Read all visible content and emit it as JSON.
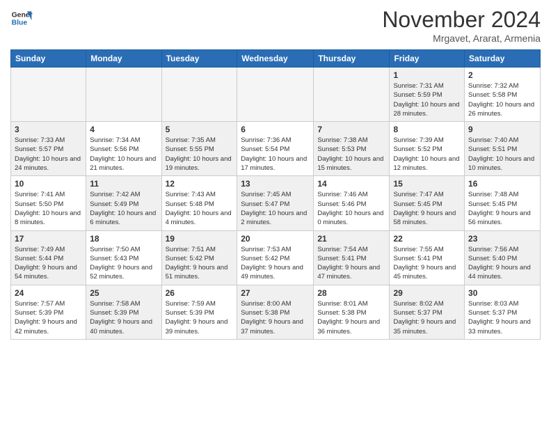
{
  "header": {
    "logo_line1": "General",
    "logo_line2": "Blue",
    "month": "November 2024",
    "location": "Mrgavet, Ararat, Armenia"
  },
  "weekdays": [
    "Sunday",
    "Monday",
    "Tuesday",
    "Wednesday",
    "Thursday",
    "Friday",
    "Saturday"
  ],
  "weeks": [
    [
      {
        "day": "",
        "info": "",
        "empty": true
      },
      {
        "day": "",
        "info": "",
        "empty": true
      },
      {
        "day": "",
        "info": "",
        "empty": true
      },
      {
        "day": "",
        "info": "",
        "empty": true
      },
      {
        "day": "",
        "info": "",
        "empty": true
      },
      {
        "day": "1",
        "info": "Sunrise: 7:31 AM\nSunset: 5:59 PM\nDaylight: 10 hours and 28 minutes.",
        "shaded": true
      },
      {
        "day": "2",
        "info": "Sunrise: 7:32 AM\nSunset: 5:58 PM\nDaylight: 10 hours and 26 minutes.",
        "shaded": false
      }
    ],
    [
      {
        "day": "3",
        "info": "Sunrise: 7:33 AM\nSunset: 5:57 PM\nDaylight: 10 hours and 24 minutes.",
        "shaded": true
      },
      {
        "day": "4",
        "info": "Sunrise: 7:34 AM\nSunset: 5:56 PM\nDaylight: 10 hours and 21 minutes.",
        "shaded": false
      },
      {
        "day": "5",
        "info": "Sunrise: 7:35 AM\nSunset: 5:55 PM\nDaylight: 10 hours and 19 minutes.",
        "shaded": true
      },
      {
        "day": "6",
        "info": "Sunrise: 7:36 AM\nSunset: 5:54 PM\nDaylight: 10 hours and 17 minutes.",
        "shaded": false
      },
      {
        "day": "7",
        "info": "Sunrise: 7:38 AM\nSunset: 5:53 PM\nDaylight: 10 hours and 15 minutes.",
        "shaded": true
      },
      {
        "day": "8",
        "info": "Sunrise: 7:39 AM\nSunset: 5:52 PM\nDaylight: 10 hours and 12 minutes.",
        "shaded": false
      },
      {
        "day": "9",
        "info": "Sunrise: 7:40 AM\nSunset: 5:51 PM\nDaylight: 10 hours and 10 minutes.",
        "shaded": true
      }
    ],
    [
      {
        "day": "10",
        "info": "Sunrise: 7:41 AM\nSunset: 5:50 PM\nDaylight: 10 hours and 8 minutes.",
        "shaded": false
      },
      {
        "day": "11",
        "info": "Sunrise: 7:42 AM\nSunset: 5:49 PM\nDaylight: 10 hours and 6 minutes.",
        "shaded": true
      },
      {
        "day": "12",
        "info": "Sunrise: 7:43 AM\nSunset: 5:48 PM\nDaylight: 10 hours and 4 minutes.",
        "shaded": false
      },
      {
        "day": "13",
        "info": "Sunrise: 7:45 AM\nSunset: 5:47 PM\nDaylight: 10 hours and 2 minutes.",
        "shaded": true
      },
      {
        "day": "14",
        "info": "Sunrise: 7:46 AM\nSunset: 5:46 PM\nDaylight: 10 hours and 0 minutes.",
        "shaded": false
      },
      {
        "day": "15",
        "info": "Sunrise: 7:47 AM\nSunset: 5:45 PM\nDaylight: 9 hours and 58 minutes.",
        "shaded": true
      },
      {
        "day": "16",
        "info": "Sunrise: 7:48 AM\nSunset: 5:45 PM\nDaylight: 9 hours and 56 minutes.",
        "shaded": false
      }
    ],
    [
      {
        "day": "17",
        "info": "Sunrise: 7:49 AM\nSunset: 5:44 PM\nDaylight: 9 hours and 54 minutes.",
        "shaded": true
      },
      {
        "day": "18",
        "info": "Sunrise: 7:50 AM\nSunset: 5:43 PM\nDaylight: 9 hours and 52 minutes.",
        "shaded": false
      },
      {
        "day": "19",
        "info": "Sunrise: 7:51 AM\nSunset: 5:42 PM\nDaylight: 9 hours and 51 minutes.",
        "shaded": true
      },
      {
        "day": "20",
        "info": "Sunrise: 7:53 AM\nSunset: 5:42 PM\nDaylight: 9 hours and 49 minutes.",
        "shaded": false
      },
      {
        "day": "21",
        "info": "Sunrise: 7:54 AM\nSunset: 5:41 PM\nDaylight: 9 hours and 47 minutes.",
        "shaded": true
      },
      {
        "day": "22",
        "info": "Sunrise: 7:55 AM\nSunset: 5:41 PM\nDaylight: 9 hours and 45 minutes.",
        "shaded": false
      },
      {
        "day": "23",
        "info": "Sunrise: 7:56 AM\nSunset: 5:40 PM\nDaylight: 9 hours and 44 minutes.",
        "shaded": true
      }
    ],
    [
      {
        "day": "24",
        "info": "Sunrise: 7:57 AM\nSunset: 5:39 PM\nDaylight: 9 hours and 42 minutes.",
        "shaded": false
      },
      {
        "day": "25",
        "info": "Sunrise: 7:58 AM\nSunset: 5:39 PM\nDaylight: 9 hours and 40 minutes.",
        "shaded": true
      },
      {
        "day": "26",
        "info": "Sunrise: 7:59 AM\nSunset: 5:39 PM\nDaylight: 9 hours and 39 minutes.",
        "shaded": false
      },
      {
        "day": "27",
        "info": "Sunrise: 8:00 AM\nSunset: 5:38 PM\nDaylight: 9 hours and 37 minutes.",
        "shaded": true
      },
      {
        "day": "28",
        "info": "Sunrise: 8:01 AM\nSunset: 5:38 PM\nDaylight: 9 hours and 36 minutes.",
        "shaded": false
      },
      {
        "day": "29",
        "info": "Sunrise: 8:02 AM\nSunset: 5:37 PM\nDaylight: 9 hours and 35 minutes.",
        "shaded": true
      },
      {
        "day": "30",
        "info": "Sunrise: 8:03 AM\nSunset: 5:37 PM\nDaylight: 9 hours and 33 minutes.",
        "shaded": false
      }
    ]
  ]
}
